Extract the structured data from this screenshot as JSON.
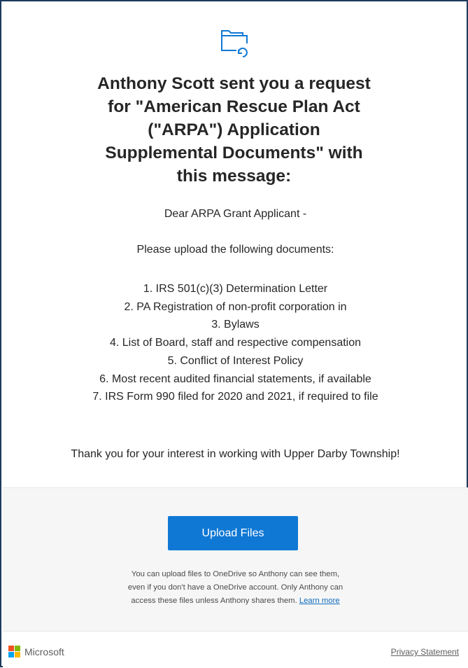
{
  "header": {
    "icon": "shared-folder-icon",
    "headline_lines": [
      "Anthony Scott sent you a request",
      "for \"American Rescue Plan Act",
      "(\"ARPA\") Application",
      "Supplemental Documents\" with",
      "this message:"
    ]
  },
  "message": {
    "greeting": "Dear ARPA Grant Applicant -",
    "intro": "Please upload the following documents:",
    "documents": [
      "1. IRS 501(c)(3) Determination Letter",
      "2. PA Registration of non-profit corporation in",
      "3. Bylaws",
      "4. List of Board, staff and respective compensation",
      "5. Conflict of Interest Policy",
      "6. Most recent audited financial statements, if available",
      "7. IRS Form 990 filed for 2020 and 2021, if required to file"
    ],
    "thanks": "Thank you for your interest in working with Upper Darby Township!"
  },
  "upload": {
    "button_label": "Upload Files",
    "note_line1": "You can upload files to OneDrive so Anthony can see them,",
    "note_line2": "even if you don't have a OneDrive account. Only Anthony can",
    "note_line3": "access these files unless Anthony shares them. ",
    "learn_more": "Learn more"
  },
  "footer": {
    "brand": "Microsoft",
    "privacy": "Privacy Statement"
  },
  "colors": {
    "accent": "#0f78d4",
    "frame_border": "#1c3a5e",
    "ms_red": "#f25022",
    "ms_green": "#7fba00",
    "ms_blue": "#00a4ef",
    "ms_yellow": "#ffb900"
  }
}
